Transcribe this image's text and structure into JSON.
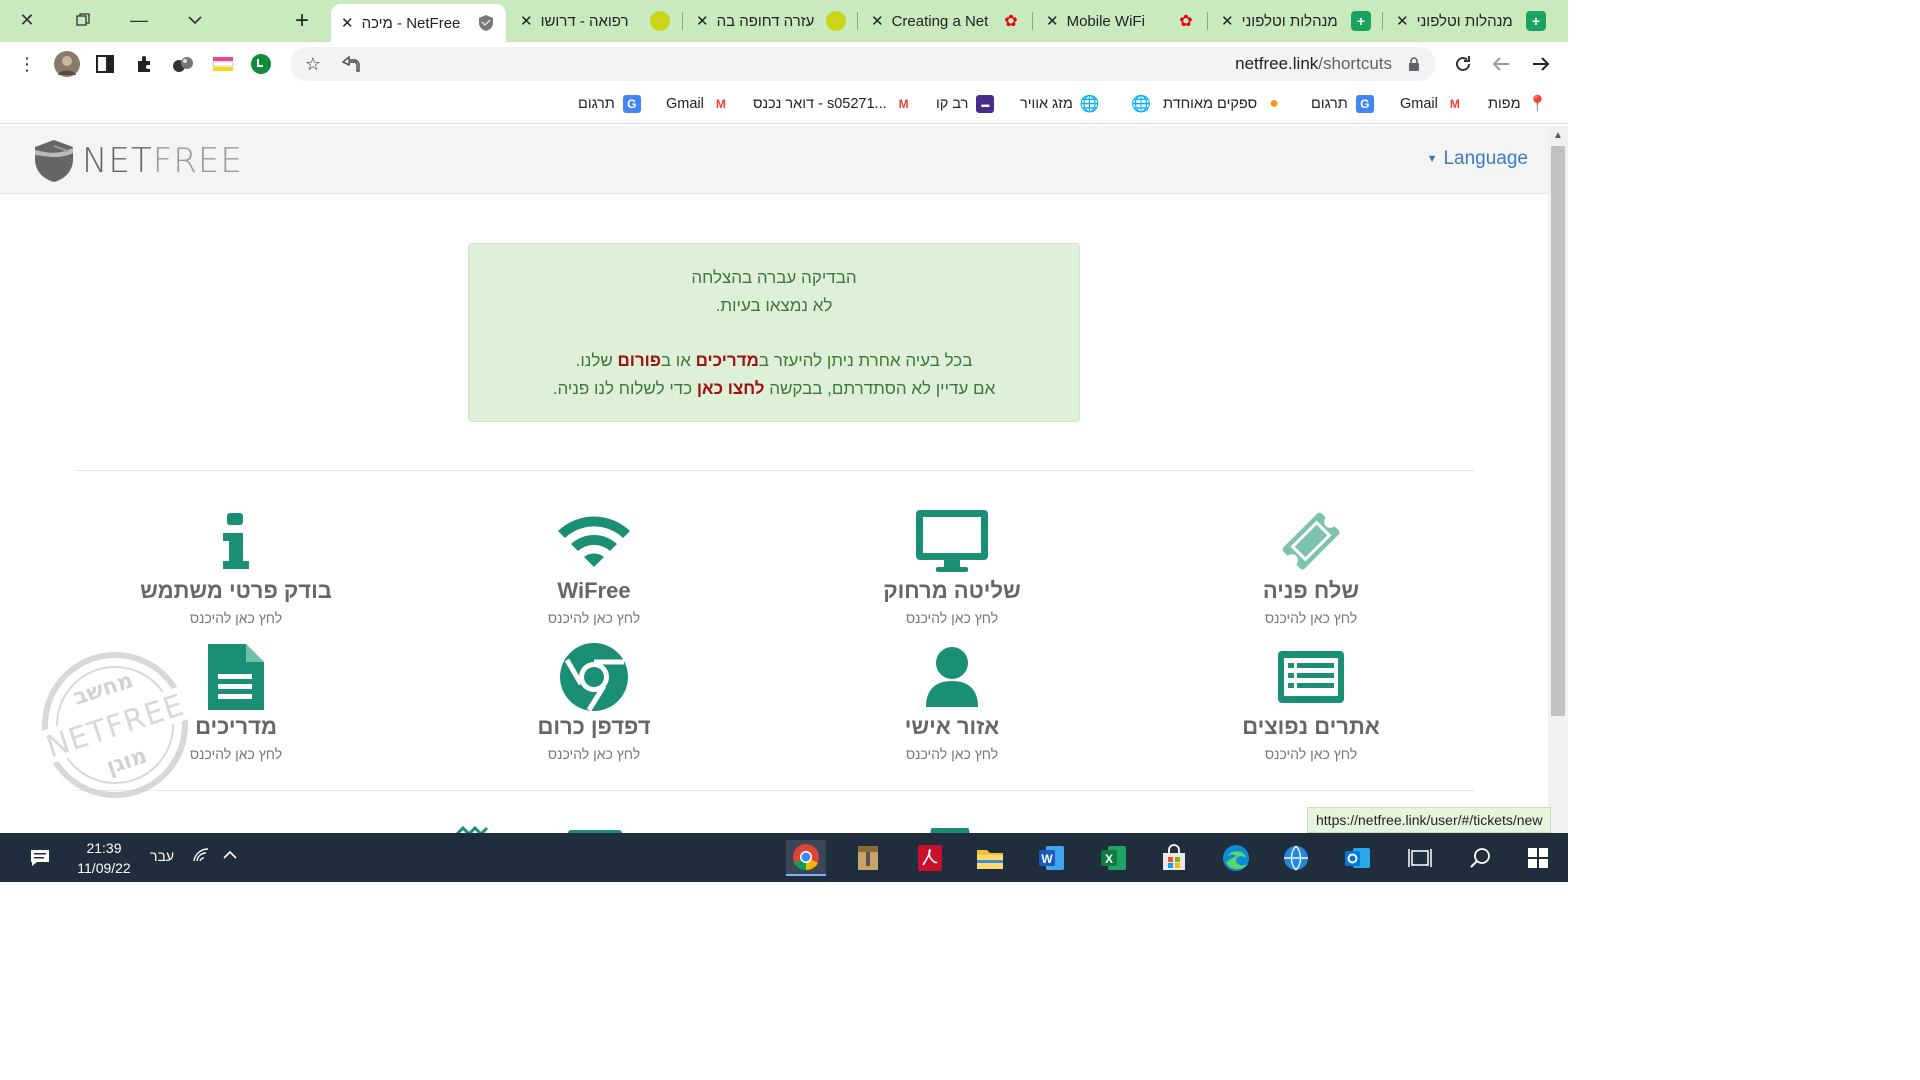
{
  "tabs": [
    {
      "title": "מנהלות וטלפוני",
      "favicon": "green-plus-icon",
      "color": "#1aa260"
    },
    {
      "title": "מנהלות וטלפוני",
      "favicon": "green-plus-icon",
      "color": "#1aa260"
    },
    {
      "title": "Mobile WiFi",
      "favicon": "huawei-icon",
      "color": "#e60012"
    },
    {
      "title": "Creating a Net",
      "favicon": "huawei-icon",
      "color": "#e60012"
    },
    {
      "title": "עזרה דחופה בה",
      "favicon": "yellow-cloud-icon",
      "color": "#c9d41a"
    },
    {
      "title": "רפואה - דרושו",
      "favicon": "yellow-cloud-icon",
      "color": "#c9d41a"
    },
    {
      "title": "NetFree - מיכה",
      "favicon": "netfree-shield-icon",
      "color": "#666666",
      "active": true
    }
  ],
  "address": {
    "host": "netfree.link",
    "path": "/shortcuts"
  },
  "bookmarks": [
    {
      "label": "מפות",
      "icon": "maps-pin-icon"
    },
    {
      "label": "Gmail",
      "icon": "gmail-icon"
    },
    {
      "label": "תרגום",
      "icon": "translate-icon"
    },
    {
      "label": "ספקים מאוחדת",
      "icon": "orange-bookmark-icon"
    },
    {
      "label": "",
      "icon": "globe-icon"
    },
    {
      "label": "מזג אוויר",
      "icon": "globe-icon"
    },
    {
      "label": "רב קו",
      "icon": "ravkav-icon"
    },
    {
      "label": "דואר נכנס - s05271...",
      "icon": "gmail-icon"
    },
    {
      "label": "Gmail",
      "icon": "gmail-icon"
    },
    {
      "label": "תרגום",
      "icon": "translate-icon"
    }
  ],
  "site": {
    "logo_main": "NET",
    "logo_light": "FREE",
    "language": "Language"
  },
  "alert": {
    "line1": "הבדיקה עברה בהצלחה",
    "line2": "לא נמצאו בעיות.",
    "line3_a": "בכל בעיה אחרת ניתן להיעזר ב",
    "line3_link1": "מדריכים",
    "line3_b": " או ב",
    "line3_link2": "פורום",
    "line3_c": " שלנו.",
    "line4_a": "אם עדיין לא הסתדרתם, בבקשה ",
    "line4_link": "לחצו כאן",
    "line4_b": " כדי לשלוח לנו פניה."
  },
  "shortcuts": [
    {
      "title": "שלח פניה",
      "sub": "לחץ כאן להיכנס",
      "icon": "ticket-icon"
    },
    {
      "title": "שליטה מרחוק",
      "sub": "לחץ כאן להיכנס",
      "icon": "monitor-icon"
    },
    {
      "title": "WiFree",
      "sub": "לחץ כאן להיכנס",
      "icon": "wifi-icon"
    },
    {
      "title": "בודק פרטי משתמש",
      "sub": "לחץ כאן להיכנס",
      "icon": "info-icon"
    },
    {
      "title": "אתרים נפוצים",
      "sub": "לחץ כאן להיכנס",
      "icon": "list-icon"
    },
    {
      "title": "אזור אישי",
      "sub": "לחץ כאן להיכנס",
      "icon": "user-icon"
    },
    {
      "title": "דפדפן כרום",
      "sub": "לחץ כאן להיכנס",
      "icon": "chrome-icon"
    },
    {
      "title": "מדריכים",
      "sub": "לחץ כאן להיכנס",
      "icon": "document-icon"
    }
  ],
  "stamp": {
    "top": "מחשב",
    "middle": "NETFREE",
    "bottom": "מוגן"
  },
  "status_url": "https://netfree.link/user/#/tickets/new",
  "taskbar": {
    "time": "21:39",
    "date": "11/09/22",
    "language": "עבר"
  },
  "colors": {
    "accent": "#1a8f76",
    "alert_bg": "#dff0d8",
    "alert_text": "#3c763d",
    "link_red": "#a01010",
    "tabstrip": "#c9e9bf"
  }
}
